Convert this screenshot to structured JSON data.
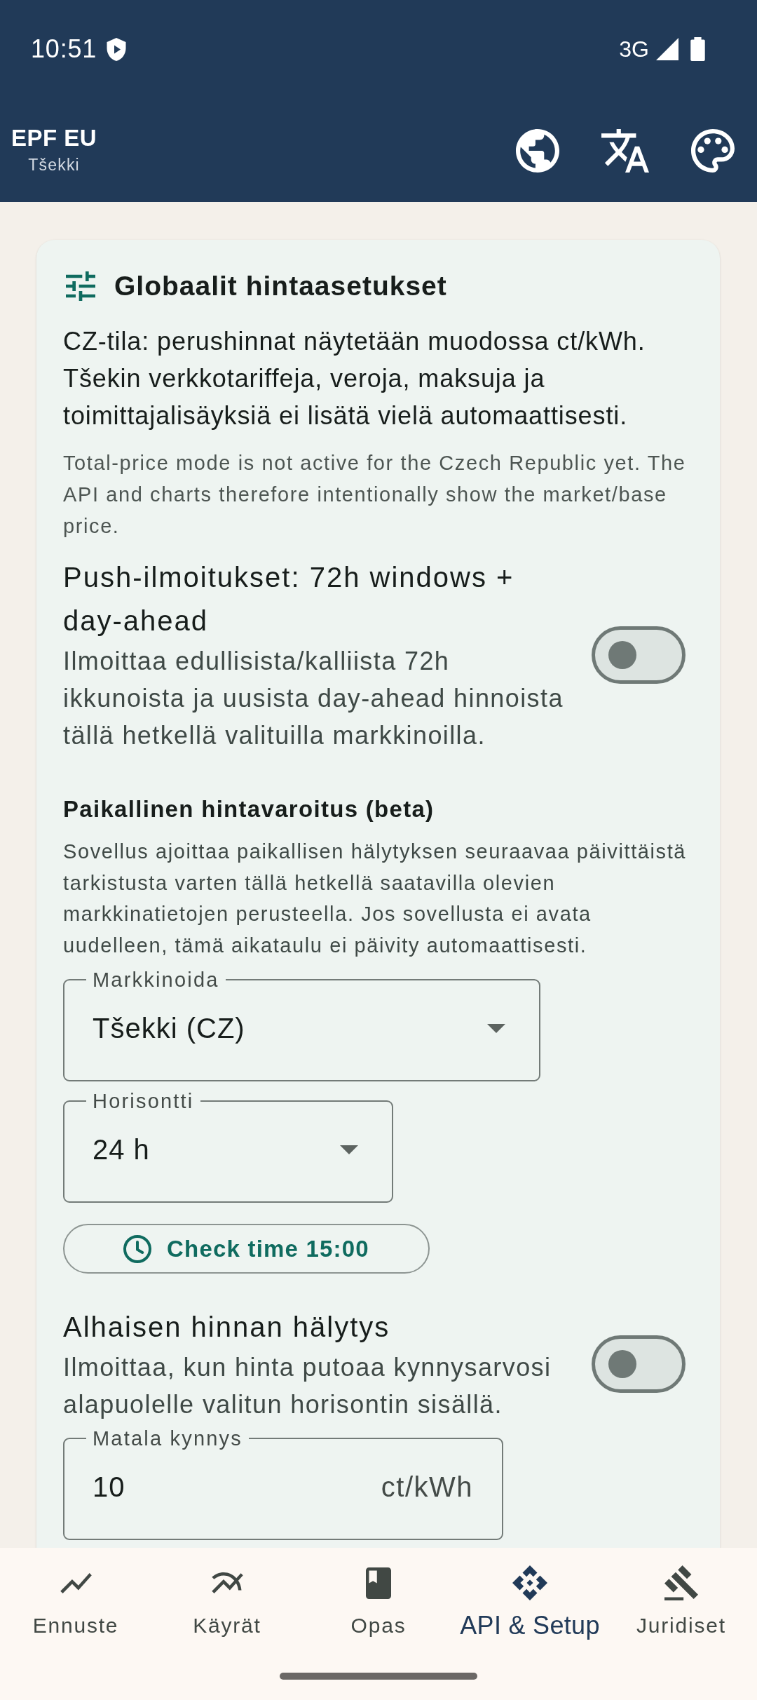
{
  "status_bar": {
    "time": "10:51",
    "network": "3G"
  },
  "app_bar": {
    "title": "EPF EU",
    "subtitle": "Tšekki"
  },
  "card": {
    "title": "Globaalit hintaasetukset",
    "intro": "CZ-tila: perushinnat näytetään muodossa ct/kWh. Tšekin verkkotariffeja, veroja, maksuja ja toimittajalisäyksiä ei lisätä vielä automaattisesti.",
    "note": "Total-price mode is not active for the Czech Republic yet. The API and charts therefore intentionally show the market/base price.",
    "push_notifications": {
      "title": "Push-ilmoitukset: 72h windows + day-ahead",
      "description": "Ilmoittaa edullisista/kalliista 72h ikkunoista ja uusista day-ahead hinnoista tällä hetkellä valituilla markkinoilla.",
      "on": false
    },
    "local_alert": {
      "heading": "Paikallinen hintavaroitus (beta)",
      "description": "Sovellus ajoittaa paikallisen hälytyksen seuraavaa päivittäistä tarkistusta varten tällä hetkellä saatavilla olevien markkinatietojen perusteella. Jos sovellusta ei avata uudelleen, tämä aikataulu ei päivity automaattisesti.",
      "market": {
        "label": "Markkinoida",
        "value": "Tšekki (CZ)"
      },
      "horizon": {
        "label": "Horisontti",
        "value": "24 h"
      },
      "check_time_button": "Check time 15:00"
    },
    "low_price_alert": {
      "title": "Alhaisen hinnan hälytys",
      "description": "Ilmoittaa, kun hinta putoaa kynnysarvosi alapuolelle valitun horisontin sisällä.",
      "on": false
    },
    "low_threshold": {
      "label": "Matala kynnys",
      "value": "10",
      "suffix": "ct/kWh"
    }
  },
  "bottom_nav": [
    {
      "label": "Ennuste",
      "selected": false
    },
    {
      "label": "Käyrät",
      "selected": false
    },
    {
      "label": "Opas",
      "selected": false
    },
    {
      "label": "API & Setup",
      "selected": true
    },
    {
      "label": "Juridiset",
      "selected": false
    }
  ]
}
